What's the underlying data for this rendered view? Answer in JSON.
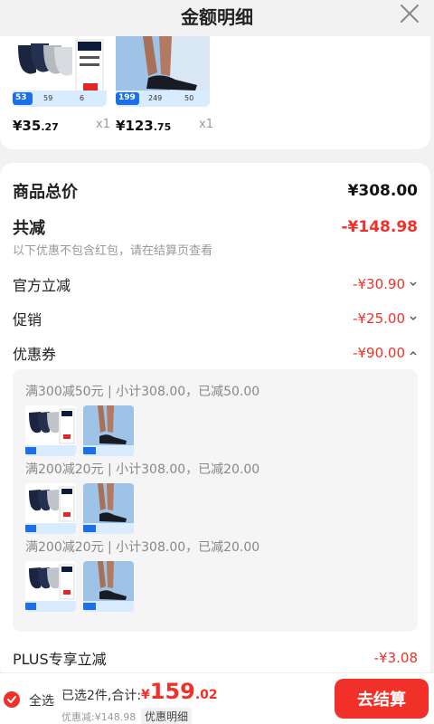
{
  "header": {
    "title": "金额明细"
  },
  "products": [
    {
      "price_int": "¥35",
      "price_dec": ".27",
      "qty": "x1",
      "badge": "53",
      "t1": "59",
      "t2": "6"
    },
    {
      "price_int": "¥123",
      "price_dec": ".75",
      "qty": "x1",
      "badge": "199",
      "t1": "249",
      "t2": "50"
    }
  ],
  "summary": {
    "goods_total_label": "商品总价",
    "goods_total_value": "¥308.00",
    "total_discount_label": "共减",
    "total_discount_value": "-¥148.98",
    "note": "以下优惠不包含红包，请在结算页查看",
    "official_label": "官方立减",
    "official_value": "-¥30.90",
    "promo_label": "促销",
    "promo_value": "-¥25.00",
    "coupon_label": "优惠券",
    "coupon_value": "-¥90.00",
    "plus_label": "PLUS专享立减",
    "plus_value": "-¥3.08"
  },
  "coupons": [
    {
      "text": "满300减50元 | 小计308.00，已减50.00"
    },
    {
      "text": "满200减20元 | 小计308.00，已减20.00"
    },
    {
      "text": "满200减20元 | 小计308.00，已减20.00"
    }
  ],
  "bottom": {
    "select_all": "全选",
    "selected_sum": "已选2件,合计:",
    "currency": "¥",
    "total_int": "159",
    "total_dec": ".02",
    "discount": "优惠减:¥148.98",
    "detail_tag": "优惠明细",
    "checkout": "去结算"
  },
  "colors": {
    "accent": "#f2302a"
  },
  "icons": [
    "close-icon",
    "chevron-down-icon",
    "chevron-up-icon",
    "check-icon"
  ]
}
